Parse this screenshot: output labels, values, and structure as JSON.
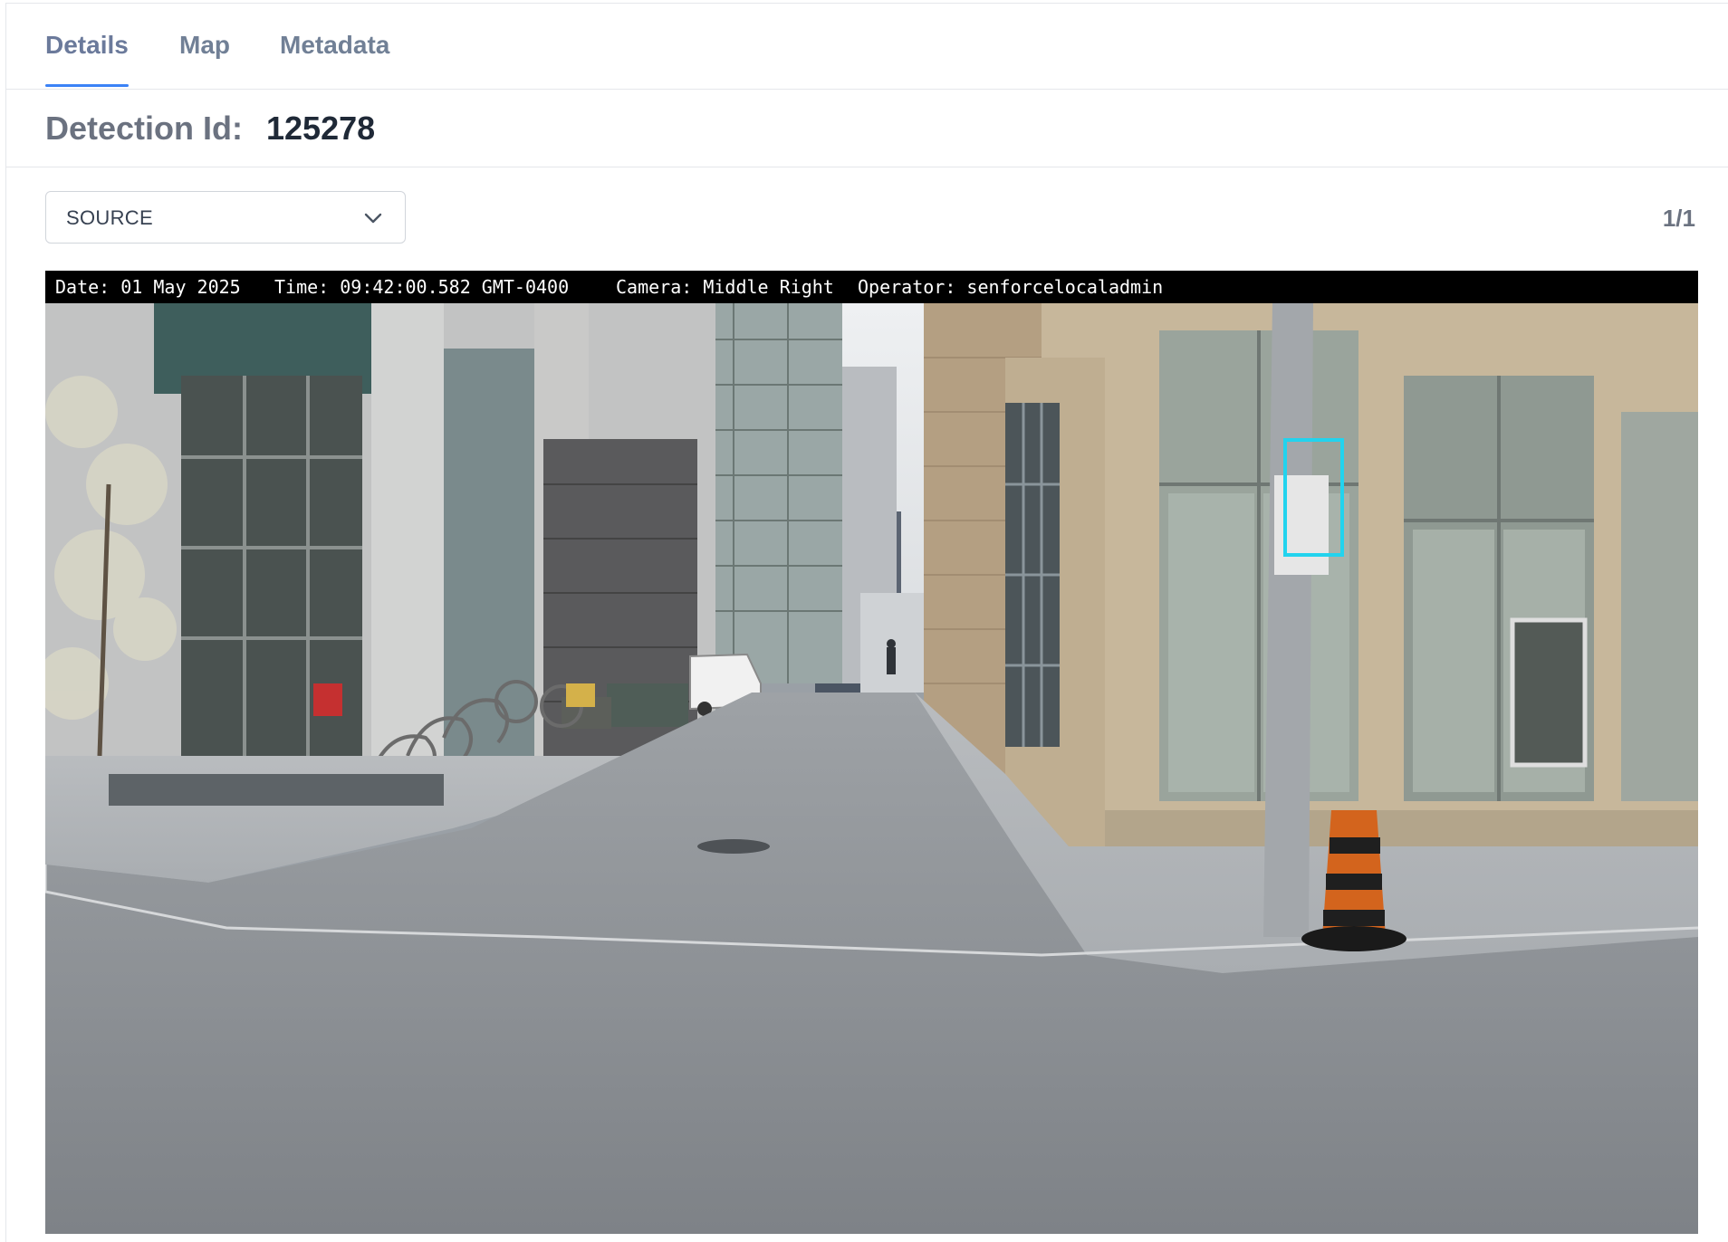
{
  "tabs": [
    {
      "label": "Details",
      "active": true
    },
    {
      "label": "Map",
      "active": false
    },
    {
      "label": "Metadata",
      "active": false
    }
  ],
  "detection": {
    "label": "Detection Id:",
    "value": "125278"
  },
  "source_select": {
    "value": "SOURCE"
  },
  "counter": "1/1",
  "image_overlay": {
    "date": "Date: 01 May 2025",
    "time": "Time: 09:42:00.582 GMT-0400",
    "camera": "Camera: Middle Right",
    "operator": "Operator: senforcelocaladmin"
  },
  "colors": {
    "active_tab_underline": "#3b82f6",
    "detection_box": "#22d3ee"
  }
}
